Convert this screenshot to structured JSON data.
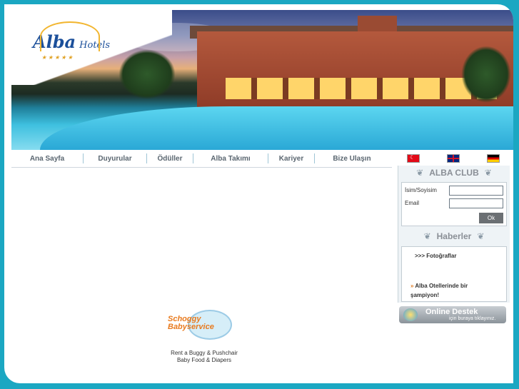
{
  "logo": {
    "brand": "Alba",
    "suffix": "Hotels",
    "stars": "★★★★★"
  },
  "nav": [
    "Ana Sayfa",
    "Duyurular",
    "Ödüller",
    "Alba Takımı",
    "Kariyer",
    "Bize Ulaşın"
  ],
  "flags": [
    {
      "name": "turkish-flag-icon"
    },
    {
      "name": "uk-flag-icon"
    },
    {
      "name": "german-flag-icon"
    }
  ],
  "club": {
    "title": "ALBA CLUB",
    "name_label": "İsim/Soyisim",
    "email_label": "Email",
    "ok_label": "Ok"
  },
  "news": {
    "title": "Haberler",
    "photos_link": ">>> Fotoğraflar",
    "item_arrow": "»",
    "item_text": "Alba Otellerinde bir şampiyon!"
  },
  "support": {
    "title": "Online Destek",
    "subtitle": "için buraya tıklayınız."
  },
  "baby": {
    "brand_line1": "Schoggy",
    "brand_line2": "Babyservice",
    "line1": "Rent a Buggy & Pushchair",
    "line2": "Baby Food & Diapers"
  }
}
